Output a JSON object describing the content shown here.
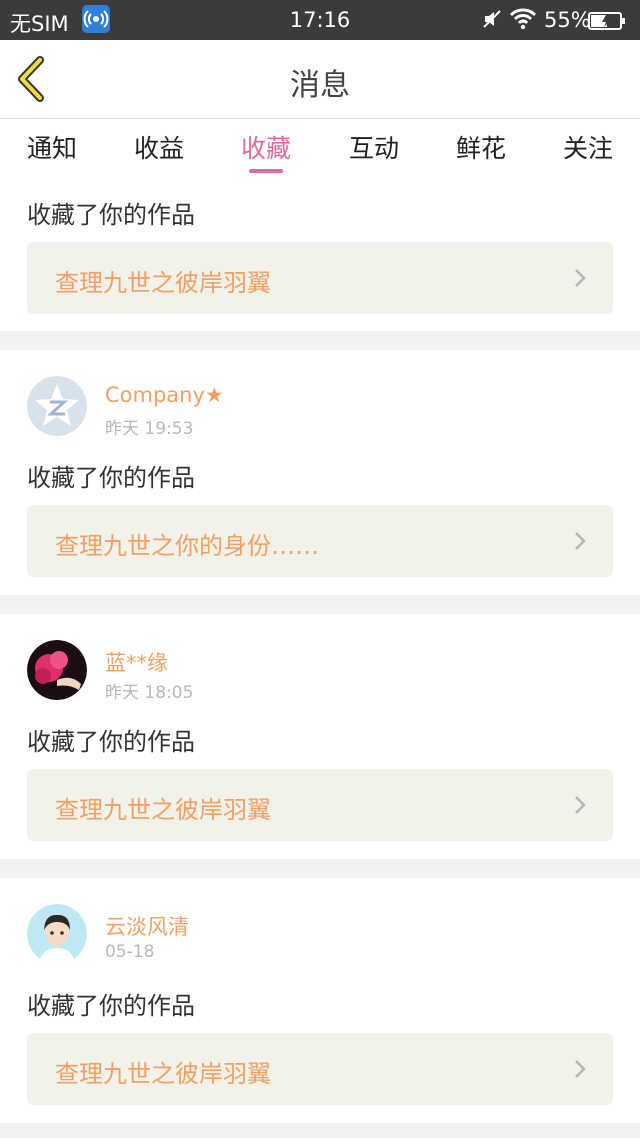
{
  "status_bar": {
    "carrier": "无SIM",
    "time": "17:16",
    "battery": "55%",
    "hotspot_icon": "hotspot-icon",
    "mute_icon": "mute-icon",
    "wifi_icon": "wifi-icon",
    "battery_icon": "battery-charging-icon"
  },
  "header": {
    "title": "消息",
    "back_icon": "back-chevron-icon",
    "accent": "#f0dc3c"
  },
  "tabs": [
    {
      "label": "通知"
    },
    {
      "label": "收益"
    },
    {
      "label": "收藏",
      "active": true
    },
    {
      "label": "互动"
    },
    {
      "label": "鲜花"
    },
    {
      "label": "关注"
    }
  ],
  "colors": {
    "tab_active": "#e06aa0",
    "name": "#f2a064",
    "work_bg": "#f3f2ea"
  },
  "items": [
    {
      "action": "收藏了你的作品",
      "work_title": "查理九世之彼岸羽翼"
    },
    {
      "name": "Company★",
      "time": "昨天 19:53",
      "action": "收藏了你的作品",
      "work_title": "查理九世之你的身份……",
      "avatar_icon": "qzone-avatar-icon"
    },
    {
      "name": "蓝**缘",
      "time": "昨天 18:05",
      "action": "收藏了你的作品",
      "work_title": "查理九世之彼岸羽翼",
      "avatar_icon": "flower-avatar-icon"
    },
    {
      "name": "云淡风清",
      "time": "05-18",
      "action": "收藏了你的作品",
      "work_title": "查理九世之彼岸羽翼",
      "avatar_icon": "cartoon-avatar-icon"
    }
  ]
}
